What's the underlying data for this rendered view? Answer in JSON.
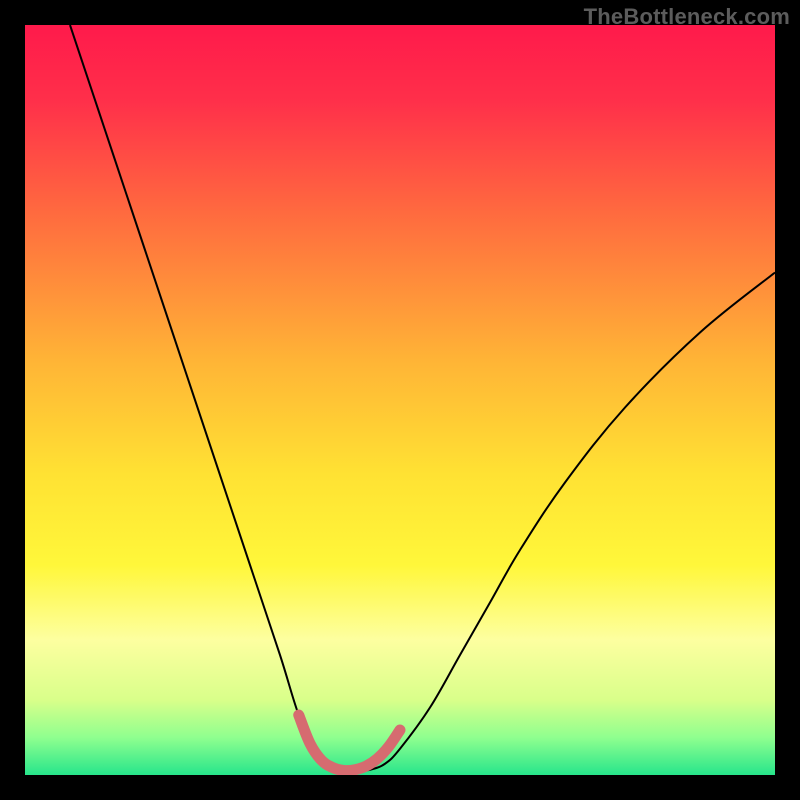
{
  "watermark": "TheBottleneck.com",
  "chart_data": {
    "type": "line",
    "title": "",
    "xlabel": "",
    "ylabel": "",
    "xlim": [
      0,
      100
    ],
    "ylim": [
      0,
      100
    ],
    "background_gradient": {
      "stops": [
        {
          "pos": 0.0,
          "color": "#ff1a4b"
        },
        {
          "pos": 0.1,
          "color": "#ff2f4a"
        },
        {
          "pos": 0.25,
          "color": "#ff6a3f"
        },
        {
          "pos": 0.45,
          "color": "#ffb536"
        },
        {
          "pos": 0.6,
          "color": "#ffe233"
        },
        {
          "pos": 0.72,
          "color": "#fff73a"
        },
        {
          "pos": 0.82,
          "color": "#fdffa0"
        },
        {
          "pos": 0.9,
          "color": "#d9ff8a"
        },
        {
          "pos": 0.95,
          "color": "#8fff8f"
        },
        {
          "pos": 1.0,
          "color": "#27e58b"
        }
      ]
    },
    "series": [
      {
        "name": "bottleneck-curve",
        "stroke": "#000000",
        "stroke_width": 2,
        "x": [
          6,
          10,
          14,
          18,
          22,
          26,
          30,
          34,
          36.5,
          38.5,
          40,
          42,
          44,
          46,
          48,
          50,
          54,
          58,
          62,
          66,
          72,
          80,
          90,
          100
        ],
        "y": [
          100,
          88,
          76,
          64,
          52,
          40,
          28,
          16,
          8,
          4,
          1.5,
          0.7,
          0.5,
          0.7,
          1.5,
          3.5,
          9,
          16,
          23,
          30,
          39,
          49,
          59,
          67
        ]
      },
      {
        "name": "bottom-marker",
        "stroke": "#d66b70",
        "stroke_width": 11,
        "linecap": "round",
        "x": [
          36.5,
          38,
          39.5,
          41,
          42.5,
          44,
          45.5,
          47,
          48.5,
          50
        ],
        "y": [
          8.0,
          4.2,
          2.0,
          1.0,
          0.6,
          0.7,
          1.2,
          2.2,
          3.8,
          6.0
        ]
      }
    ]
  }
}
